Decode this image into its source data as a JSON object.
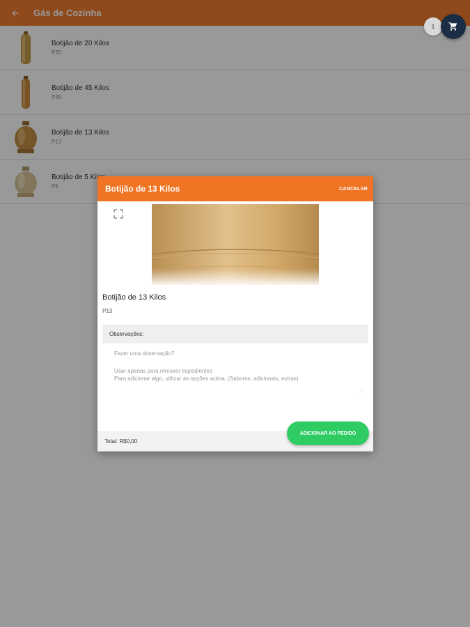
{
  "appbar": {
    "title": "Gás de Cozinha",
    "back_icon": "arrow-left-icon"
  },
  "products": [
    {
      "name": "Botijão de 20 Kilos",
      "code": "P20"
    },
    {
      "name": "Botijão de 45 Kilos",
      "code": "P45"
    },
    {
      "name": "Botijão de 13 Kilos",
      "code": "P13"
    },
    {
      "name": "Botijão de 5 Kilos",
      "code": "P5"
    }
  ],
  "cart": {
    "count": "1",
    "icon": "shopping-cart-icon"
  },
  "dialog": {
    "title": "Botijão de 13 Kilos",
    "cancel_label": "CANCELAR",
    "product_name": "Botijão de 13 Kilos",
    "product_code": "P13",
    "observations_title": "Observações:",
    "observation_placeholder": "Fazer uma observação?",
    "observation_hint": "Usar apenas para remover ingredientes\nPara adicionar algo, utilizar as opções acima. (Sabores, adicionais, extras)",
    "total": "Total: R$0,00",
    "add_label": "ADICIONAR AO PEDIDO"
  },
  "colors": {
    "appbar": "#ee7a2d",
    "dialog_header": "#f07424",
    "add_button": "#2ecc63",
    "cart_button": "#1a2d44"
  }
}
